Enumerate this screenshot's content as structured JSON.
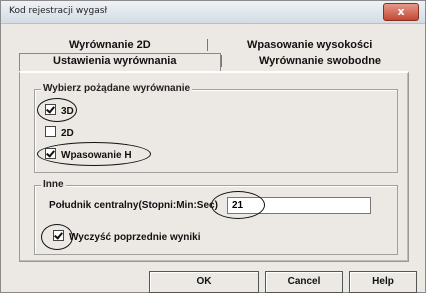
{
  "window": {
    "title": "Kod rejestracji wygasł",
    "close_glyph": "x"
  },
  "tabs": {
    "top_row": [
      "Wyrównanie 2D",
      "Wpasowanie wysokości"
    ],
    "bottom_row": [
      "Ustawienia wyrównania",
      "Wyrównanie swobodne"
    ],
    "active": "Ustawienia wyrównania"
  },
  "alignment_group": {
    "title": "Wybierz pożądane wyrównanie",
    "options": [
      {
        "label": "3D",
        "checked": true
      },
      {
        "label": "2D",
        "checked": false
      },
      {
        "label": "Wpasowanie H",
        "checked": true
      }
    ]
  },
  "other_group": {
    "title": "Inne",
    "meridian_label": "Południk centralny(Stopni:Min:Sec)",
    "meridian_value": "21",
    "clear_label": "Wyczyść poprzednie wyniki",
    "clear_checked": true
  },
  "buttons": {
    "ok": "OK",
    "cancel": "Cancel",
    "help": "Help"
  },
  "colors": {
    "dialog_bg": "#ece9e4",
    "close_button": "#c24a36"
  }
}
